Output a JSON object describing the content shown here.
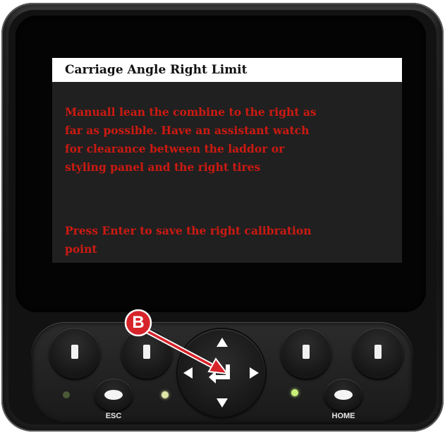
{
  "screen": {
    "title": "Carriage Angle Right Limit",
    "instructions": "Manuall lean the combine to the right as\nfar as possible.  Have an assistant watch\nfor clearance between the laddor or\nstyling panel and the right tires",
    "save_prompt": "Press Enter to save the right calibration\npoint",
    "title_bg": "#ffffff",
    "body_bg": "#202020",
    "message_color": "#cc1a12"
  },
  "keypad": {
    "esc_label": "ESC",
    "home_label": "HOME",
    "enter_icon": "enter-return-icon"
  },
  "callout": {
    "letter": "B",
    "color": "#d7232a"
  },
  "leds": {
    "left_color": "#4a5a36",
    "center_color": "#e0e6a8",
    "right_color": "#c8f07a"
  }
}
